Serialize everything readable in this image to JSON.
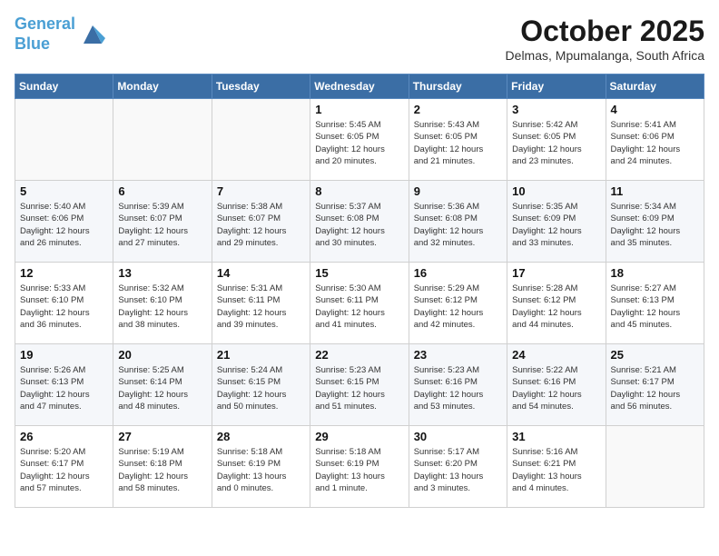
{
  "header": {
    "logo_line1": "General",
    "logo_line2": "Blue",
    "month": "October 2025",
    "location": "Delmas, Mpumalanga, South Africa"
  },
  "weekdays": [
    "Sunday",
    "Monday",
    "Tuesday",
    "Wednesday",
    "Thursday",
    "Friday",
    "Saturday"
  ],
  "weeks": [
    [
      {
        "day": "",
        "info": ""
      },
      {
        "day": "",
        "info": ""
      },
      {
        "day": "",
        "info": ""
      },
      {
        "day": "1",
        "info": "Sunrise: 5:45 AM\nSunset: 6:05 PM\nDaylight: 12 hours\nand 20 minutes."
      },
      {
        "day": "2",
        "info": "Sunrise: 5:43 AM\nSunset: 6:05 PM\nDaylight: 12 hours\nand 21 minutes."
      },
      {
        "day": "3",
        "info": "Sunrise: 5:42 AM\nSunset: 6:05 PM\nDaylight: 12 hours\nand 23 minutes."
      },
      {
        "day": "4",
        "info": "Sunrise: 5:41 AM\nSunset: 6:06 PM\nDaylight: 12 hours\nand 24 minutes."
      }
    ],
    [
      {
        "day": "5",
        "info": "Sunrise: 5:40 AM\nSunset: 6:06 PM\nDaylight: 12 hours\nand 26 minutes."
      },
      {
        "day": "6",
        "info": "Sunrise: 5:39 AM\nSunset: 6:07 PM\nDaylight: 12 hours\nand 27 minutes."
      },
      {
        "day": "7",
        "info": "Sunrise: 5:38 AM\nSunset: 6:07 PM\nDaylight: 12 hours\nand 29 minutes."
      },
      {
        "day": "8",
        "info": "Sunrise: 5:37 AM\nSunset: 6:08 PM\nDaylight: 12 hours\nand 30 minutes."
      },
      {
        "day": "9",
        "info": "Sunrise: 5:36 AM\nSunset: 6:08 PM\nDaylight: 12 hours\nand 32 minutes."
      },
      {
        "day": "10",
        "info": "Sunrise: 5:35 AM\nSunset: 6:09 PM\nDaylight: 12 hours\nand 33 minutes."
      },
      {
        "day": "11",
        "info": "Sunrise: 5:34 AM\nSunset: 6:09 PM\nDaylight: 12 hours\nand 35 minutes."
      }
    ],
    [
      {
        "day": "12",
        "info": "Sunrise: 5:33 AM\nSunset: 6:10 PM\nDaylight: 12 hours\nand 36 minutes."
      },
      {
        "day": "13",
        "info": "Sunrise: 5:32 AM\nSunset: 6:10 PM\nDaylight: 12 hours\nand 38 minutes."
      },
      {
        "day": "14",
        "info": "Sunrise: 5:31 AM\nSunset: 6:11 PM\nDaylight: 12 hours\nand 39 minutes."
      },
      {
        "day": "15",
        "info": "Sunrise: 5:30 AM\nSunset: 6:11 PM\nDaylight: 12 hours\nand 41 minutes."
      },
      {
        "day": "16",
        "info": "Sunrise: 5:29 AM\nSunset: 6:12 PM\nDaylight: 12 hours\nand 42 minutes."
      },
      {
        "day": "17",
        "info": "Sunrise: 5:28 AM\nSunset: 6:12 PM\nDaylight: 12 hours\nand 44 minutes."
      },
      {
        "day": "18",
        "info": "Sunrise: 5:27 AM\nSunset: 6:13 PM\nDaylight: 12 hours\nand 45 minutes."
      }
    ],
    [
      {
        "day": "19",
        "info": "Sunrise: 5:26 AM\nSunset: 6:13 PM\nDaylight: 12 hours\nand 47 minutes."
      },
      {
        "day": "20",
        "info": "Sunrise: 5:25 AM\nSunset: 6:14 PM\nDaylight: 12 hours\nand 48 minutes."
      },
      {
        "day": "21",
        "info": "Sunrise: 5:24 AM\nSunset: 6:15 PM\nDaylight: 12 hours\nand 50 minutes."
      },
      {
        "day": "22",
        "info": "Sunrise: 5:23 AM\nSunset: 6:15 PM\nDaylight: 12 hours\nand 51 minutes."
      },
      {
        "day": "23",
        "info": "Sunrise: 5:23 AM\nSunset: 6:16 PM\nDaylight: 12 hours\nand 53 minutes."
      },
      {
        "day": "24",
        "info": "Sunrise: 5:22 AM\nSunset: 6:16 PM\nDaylight: 12 hours\nand 54 minutes."
      },
      {
        "day": "25",
        "info": "Sunrise: 5:21 AM\nSunset: 6:17 PM\nDaylight: 12 hours\nand 56 minutes."
      }
    ],
    [
      {
        "day": "26",
        "info": "Sunrise: 5:20 AM\nSunset: 6:17 PM\nDaylight: 12 hours\nand 57 minutes."
      },
      {
        "day": "27",
        "info": "Sunrise: 5:19 AM\nSunset: 6:18 PM\nDaylight: 12 hours\nand 58 minutes."
      },
      {
        "day": "28",
        "info": "Sunrise: 5:18 AM\nSunset: 6:19 PM\nDaylight: 13 hours\nand 0 minutes."
      },
      {
        "day": "29",
        "info": "Sunrise: 5:18 AM\nSunset: 6:19 PM\nDaylight: 13 hours\nand 1 minute."
      },
      {
        "day": "30",
        "info": "Sunrise: 5:17 AM\nSunset: 6:20 PM\nDaylight: 13 hours\nand 3 minutes."
      },
      {
        "day": "31",
        "info": "Sunrise: 5:16 AM\nSunset: 6:21 PM\nDaylight: 13 hours\nand 4 minutes."
      },
      {
        "day": "",
        "info": ""
      }
    ]
  ]
}
